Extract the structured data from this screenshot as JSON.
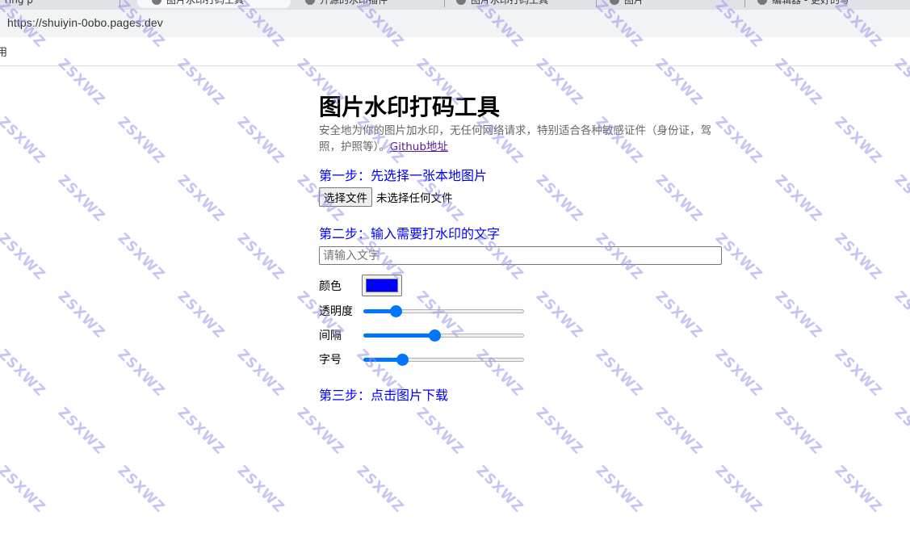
{
  "browser": {
    "tabs": [
      {
        "label": "ring p"
      },
      {
        "label": "图片水印打码工具"
      },
      {
        "label": "开源的水印插件"
      },
      {
        "label": "图片水印打码工具"
      },
      {
        "label": "图片"
      },
      {
        "label": "编辑器 - 更好的写"
      }
    ],
    "url": "https://shuiyin-0obo.pages.dev",
    "bookmark_glyph": "用"
  },
  "page": {
    "title": "图片水印打码工具",
    "description": "安全地为你的图片加水印，无任何网络请求，特别适合各种敏感证件（身份证，驾照，护照等）。",
    "github_link": "Github地址",
    "step1": "第一步：先选择一张本地图片",
    "file_button": "选择文件",
    "file_status": "未选择任何文件",
    "step2": "第二步：输入需要打水印的文字",
    "text_placeholder": "请输入文字",
    "text_value": "",
    "color_label": "颜色",
    "color_value": "#0000ff",
    "opacity_label": "透明度",
    "opacity_value": 0.18,
    "spacing_label": "间隔",
    "spacing_value": 0.44,
    "fontsize_label": "字号",
    "fontsize_value": 0.22,
    "step3": "第三步：点击图片下载"
  },
  "watermark": {
    "text": "ZSXWZ",
    "color": "#9696eb"
  }
}
